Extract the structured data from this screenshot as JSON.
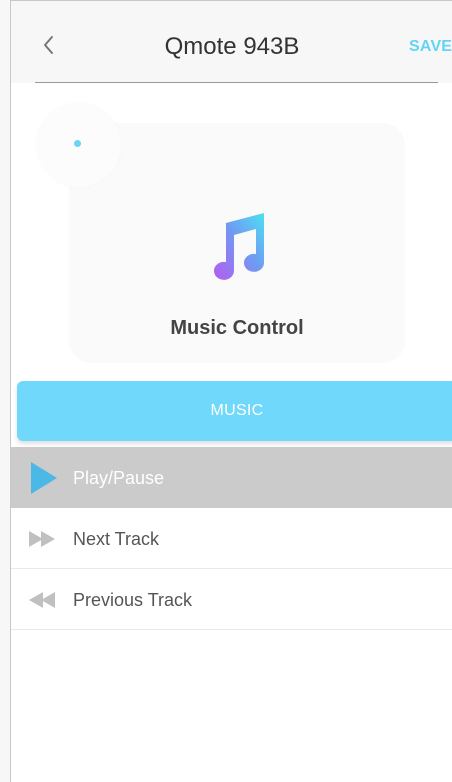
{
  "header": {
    "back_icon": "chevron-left-icon",
    "title": "Qmote 943B",
    "save_label": "SAVE"
  },
  "card": {
    "icon": "music-note-icon",
    "label": "Music Control"
  },
  "section": {
    "label": "MUSIC"
  },
  "actions": [
    {
      "label": "Play/Pause",
      "icon": "play-icon",
      "selected": true
    },
    {
      "label": "Next Track",
      "icon": "fast-forward-icon",
      "selected": false
    },
    {
      "label": "Previous Track",
      "icon": "rewind-icon",
      "selected": false
    }
  ],
  "colors": {
    "accent": "#6fd8fb",
    "selected_row": "#cbcbcb",
    "icon_gray": "#c0c0c0",
    "play_icon": "#4cb8e6"
  }
}
